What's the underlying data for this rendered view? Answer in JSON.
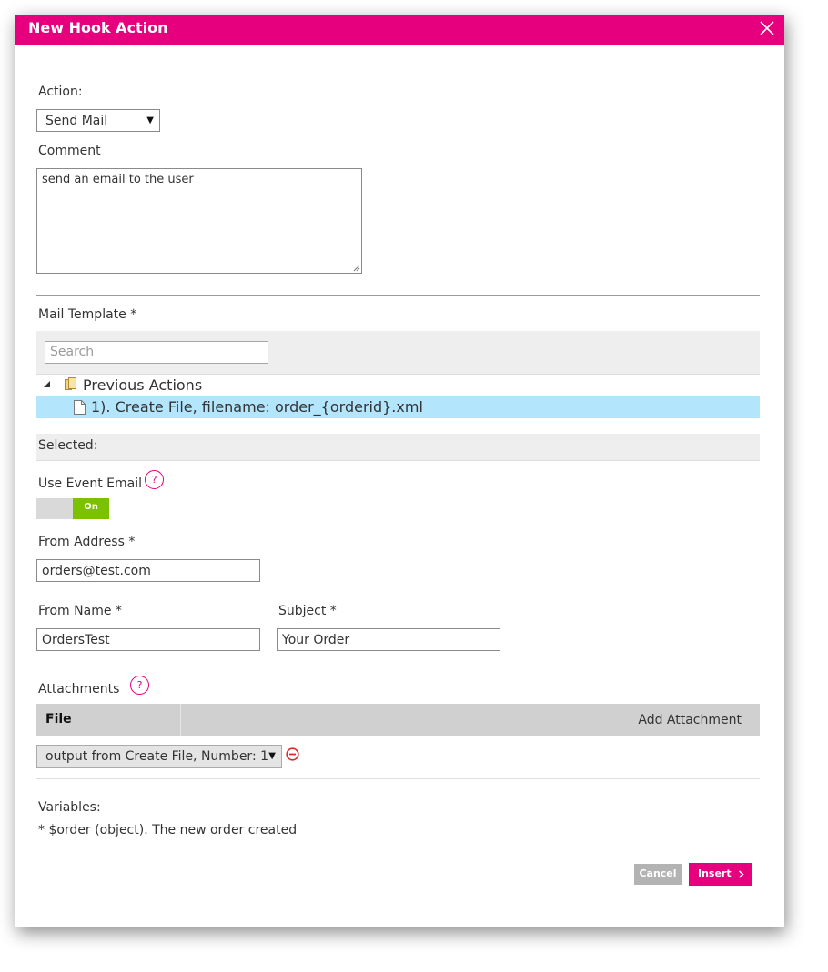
{
  "dialog": {
    "title": "New Hook Action",
    "close_icon": "close-icon"
  },
  "action": {
    "label": "Action:",
    "selected": "Send Mail"
  },
  "comment": {
    "label": "Comment",
    "value": "send an email to the user"
  },
  "mail_template": {
    "label": "Mail Template *",
    "search_placeholder": "Search",
    "tree": {
      "folder_label": "Previous Actions",
      "items": [
        {
          "label": "1). Create File, filename: order_{orderid}.xml",
          "selected": true
        }
      ]
    },
    "selected_label": "Selected:"
  },
  "use_event_email": {
    "label": "Use Event Email",
    "help": "?",
    "toggle_state": "On"
  },
  "from_address": {
    "label": "From Address *",
    "value": "orders@test.com"
  },
  "from_name": {
    "label": "From Name *",
    "value": "OrdersTest"
  },
  "subject": {
    "label": "Subject *",
    "value": "Your Order"
  },
  "attachments": {
    "label": "Attachments",
    "help": "?",
    "column_header": "File",
    "add_label": "Add Attachment",
    "rows": [
      {
        "selected": "output from Create File, Number: 1"
      }
    ]
  },
  "variables": {
    "label": "Variables:",
    "lines": [
      "* $order (object). The new order created"
    ]
  },
  "buttons": {
    "cancel_label": "Cancel",
    "insert_label": "Insert",
    "insert_icon": "chevron-right-icon"
  },
  "colors": {
    "accent": "#e6007e",
    "toggle_on": "#7ac100",
    "selection_bg": "#b3e5fc",
    "panel_bg": "#eeeeee"
  }
}
